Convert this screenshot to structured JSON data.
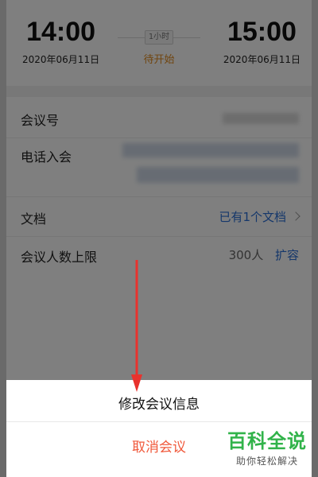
{
  "meeting": {
    "start_time": "14:00",
    "start_date": "2020年06月11日",
    "duration": "1小时",
    "status": "待开始",
    "end_time": "15:00",
    "end_date": "2020年06月11日"
  },
  "details": {
    "meeting_id_label": "会议号",
    "phone_join_label": "电话入会",
    "docs_label": "文档",
    "docs_value": "已有1个文档",
    "capacity_label": "会议人数上限",
    "capacity_value": "300人",
    "expand_label": "扩容"
  },
  "sheet": {
    "modify_label": "修改会议信息",
    "cancel_label": "取消会议"
  },
  "watermark": {
    "brand": "百科全说",
    "tagline": "助你轻松解决"
  },
  "colors": {
    "status_orange": "#e08a1e",
    "link_blue": "#2a6fd6",
    "cancel_red": "#f0583a",
    "arrow_red": "#e8322d",
    "brand_green": "#31b34a"
  },
  "icons": [
    "chevron-right-icon",
    "red-arrow-annotation"
  ]
}
